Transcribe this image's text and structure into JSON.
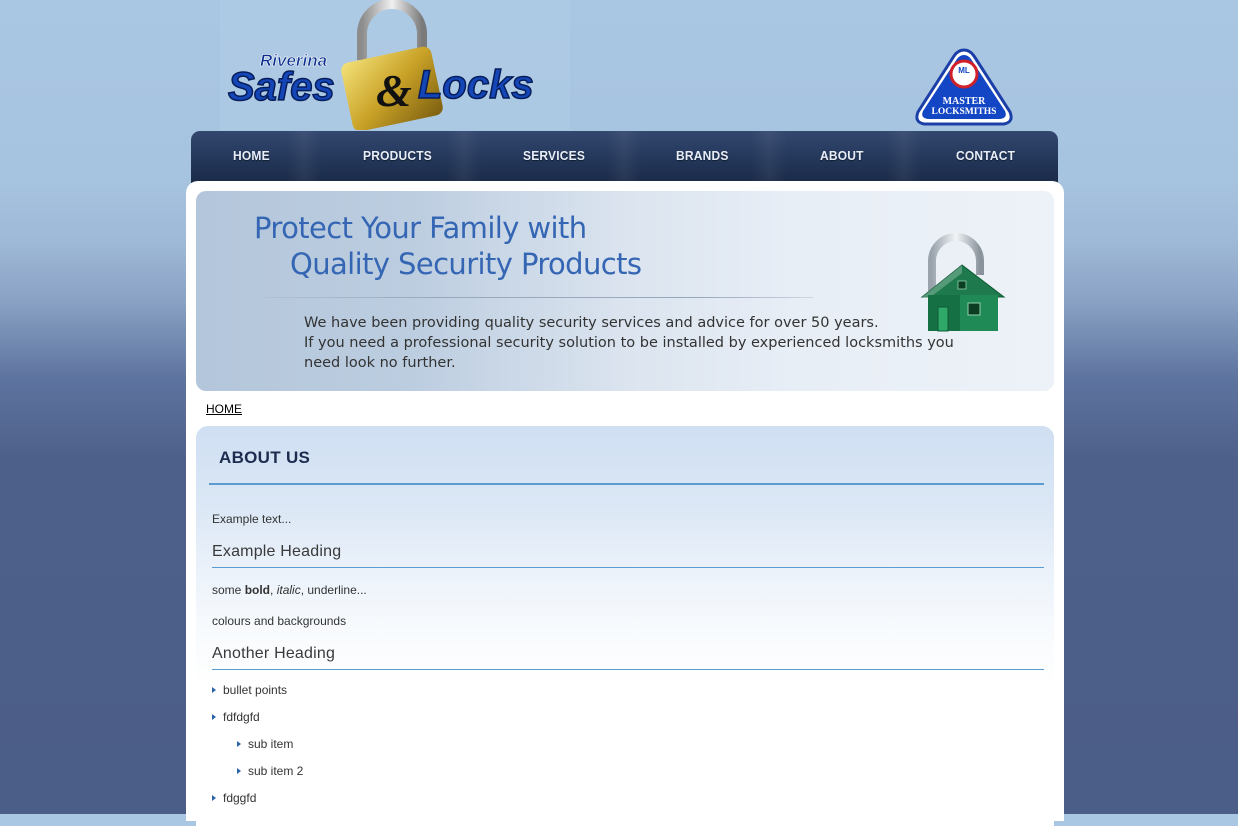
{
  "header": {
    "logo_top": "Riverina",
    "logo_main_1": "Safes",
    "logo_amp": "&",
    "logo_main_2": "Locks",
    "badge_line1": "MASTER",
    "badge_line2": "LOCKSMITHS",
    "badge_mark": "ML"
  },
  "nav": {
    "items": [
      {
        "label": "HOME"
      },
      {
        "label": "PRODUCTS"
      },
      {
        "label": "SERVICES"
      },
      {
        "label": "BRANDS"
      },
      {
        "label": "ABOUT"
      },
      {
        "label": "CONTACT"
      }
    ]
  },
  "banner": {
    "headline_1": "Protect Your Family with",
    "headline_2": "Quality Security Products",
    "line_1": "We have been providing quality security services and advice for over 50 years.",
    "line_2": "If you need a professional security solution to be installed by experienced locksmiths you",
    "line_3": "need look no further."
  },
  "breadcrumb": "HOME",
  "content": {
    "title": "ABOUT US",
    "example_text": "Example text...",
    "heading_1": "Example Heading",
    "format_1": "some ",
    "format_bold": "bold",
    "format_2": ", ",
    "format_italic": "italic",
    "format_3": ", underline...",
    "colours_text": "colours and backgrounds",
    "heading_2": "Another Heading",
    "bullets": [
      "bullet points",
      "fdfdgfd",
      "sub item",
      "sub item 2",
      "fdggfd"
    ]
  },
  "colors": {
    "nav_bg": "#263a5e",
    "accent_rule": "#5a9bd0",
    "banner_heading": "#3566b4",
    "title": "#1d2b4f"
  }
}
